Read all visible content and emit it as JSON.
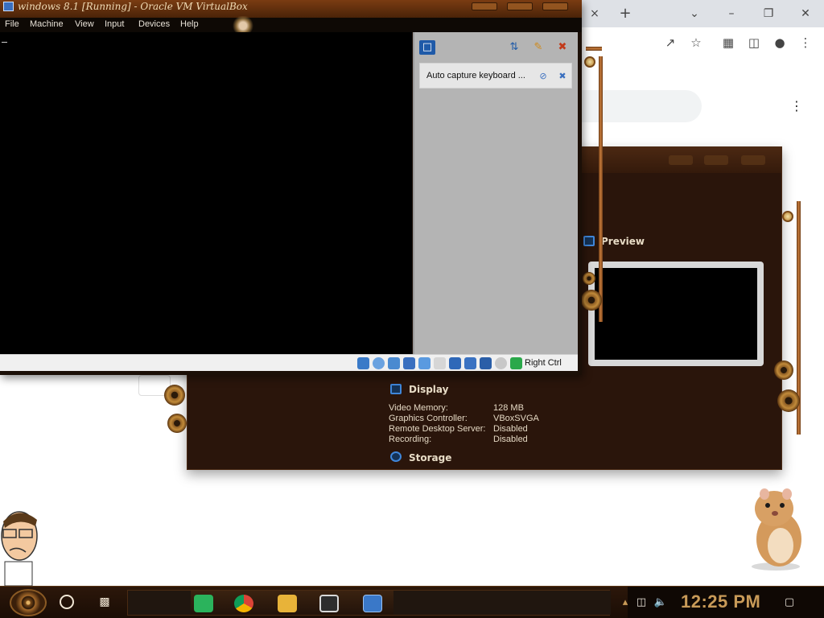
{
  "vm_window": {
    "title": "windows 8.1 [Running] - Oracle VM VirtualBox",
    "menu": [
      "File",
      "Machine",
      "View",
      "Input",
      "Devices",
      "Help"
    ],
    "notification": "Auto capture keyboard ...",
    "host_key": "Right Ctrl"
  },
  "manager": {
    "preview_title": "Preview",
    "display_title": "Display",
    "display_rows": [
      {
        "label": "Video Memory:",
        "value": "128 MB"
      },
      {
        "label": "Graphics Controller:",
        "value": "VBoxSVGA"
      },
      {
        "label": "Remote Desktop Server:",
        "value": "Disabled"
      },
      {
        "label": "Recording:",
        "value": "Disabled"
      }
    ],
    "storage_title": "Storage"
  },
  "browser": {
    "tab_close": "×",
    "new_tab": "+",
    "menu_kebab": "⋮"
  },
  "taskbar": {
    "clock": "12:25 PM",
    "apps": [
      "start-button",
      "search-icon",
      "task-view-icon",
      "notes-app-icon",
      "chrome-icon",
      "file-explorer-icon",
      "virtualbox-icon",
      "windows-8-1-vm-icon"
    ]
  },
  "colors": {
    "steampunk_brown": "#2a150b",
    "copper": "#c77b3b",
    "clock_gold": "#c89a58",
    "notify_blue": "#3a6fbf"
  }
}
